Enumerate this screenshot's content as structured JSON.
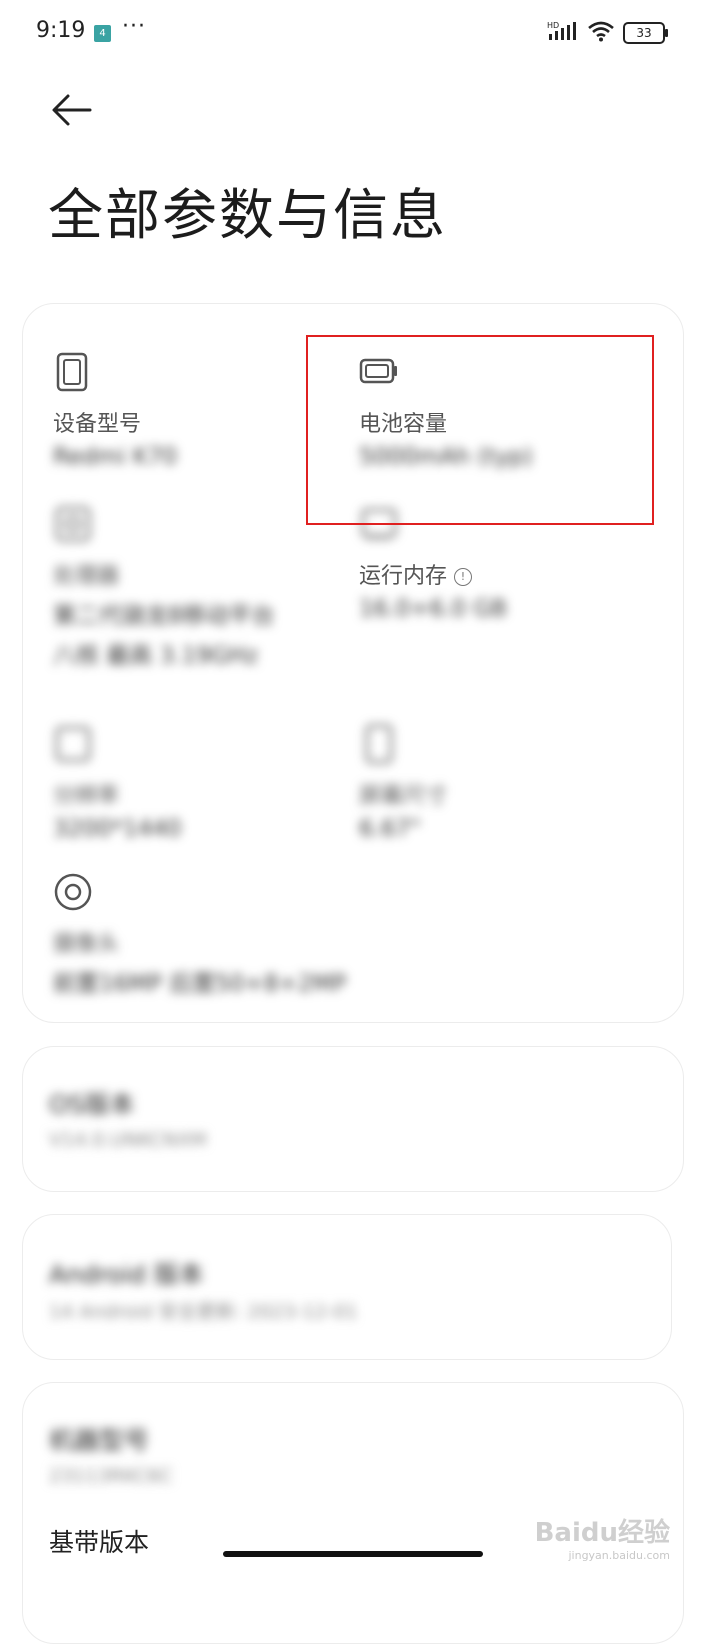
{
  "status_bar": {
    "time": "9:19",
    "notification_count": "4",
    "dots": "···",
    "network": "HD",
    "battery": "33"
  },
  "header": {
    "title": "全部参数与信息"
  },
  "specs": [
    {
      "icon": "phone-icon",
      "label": "设备型号",
      "value": "Redmi K70"
    },
    {
      "icon": "battery-icon",
      "label": "电池容量",
      "value": "5000mAh (typ)"
    },
    {
      "icon": "processor-icon",
      "label": "处理器",
      "value": "第二代骁龙8移动平台",
      "extra": "八核 最高 3.19GHz"
    },
    {
      "icon": "memory-icon",
      "label": "运行内存",
      "value": "16.0+6.0 GB"
    },
    {
      "icon": "screen-icon",
      "label": "分辨率",
      "value": "3200*1440"
    },
    {
      "icon": "screen-size-icon",
      "label": "屏幕尺寸",
      "value": "6.67\""
    },
    {
      "icon": "camera-icon",
      "label": "摄像头",
      "value": "前置16MP 后置50+8+2MP"
    }
  ],
  "rows": [
    {
      "title": "OS版本",
      "subtitle": "V14.0.UNKCNXM"
    },
    {
      "title": "Android 版本",
      "subtitle": "14 Android 安全更新: 2023-12-01"
    },
    {
      "title": "机器型号",
      "subtitle": "23113RKC6C"
    },
    {
      "title": "基带版本"
    }
  ],
  "watermark": {
    "brand": "Baidu经验",
    "url": "jingyan.baidu.com"
  },
  "colors": {
    "highlight": "#e02020",
    "card_border": "#ececec"
  }
}
